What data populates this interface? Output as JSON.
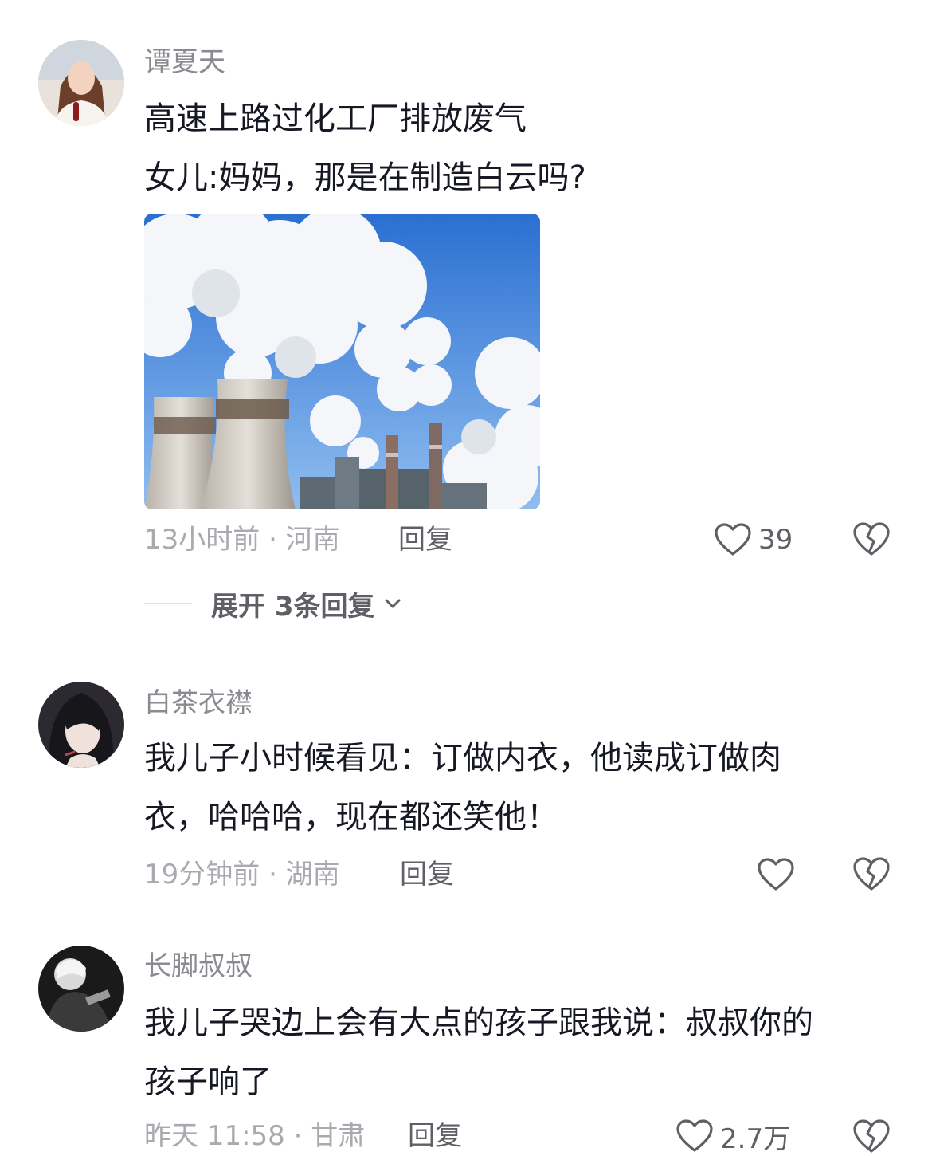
{
  "comments": [
    {
      "username": "谭夏天",
      "lines": [
        "高速上路过化工厂排放废气",
        "女儿:妈妈，那是在制造白云吗?"
      ],
      "meta": "13小时前 · 河南",
      "reply": "回复",
      "likes": "39",
      "expand": "展开 3条回复"
    },
    {
      "username": "白茶衣襟",
      "lines": [
        "我儿子小时候看见：订做内衣，他读成订做肉",
        "衣，哈哈哈，现在都还笑他！"
      ],
      "meta": "19分钟前 · 湖南",
      "reply": "回复",
      "likes": ""
    },
    {
      "username": "长脚叔叔",
      "lines": [
        "我儿子哭边上会有大点的孩子跟我说：叔叔你的",
        "孩子响了"
      ],
      "meta": "昨天 11:58 · 甘肃",
      "reply": "回复",
      "likes": "2.7万"
    }
  ],
  "icons": {
    "like": "heart-outline-icon",
    "dislike": "broken-heart-icon",
    "expand": "chevron-down-icon"
  },
  "colors": {
    "username": "#8a8b91",
    "meta": "#a9aab0",
    "action": "#5f6066",
    "text": "#161823"
  }
}
